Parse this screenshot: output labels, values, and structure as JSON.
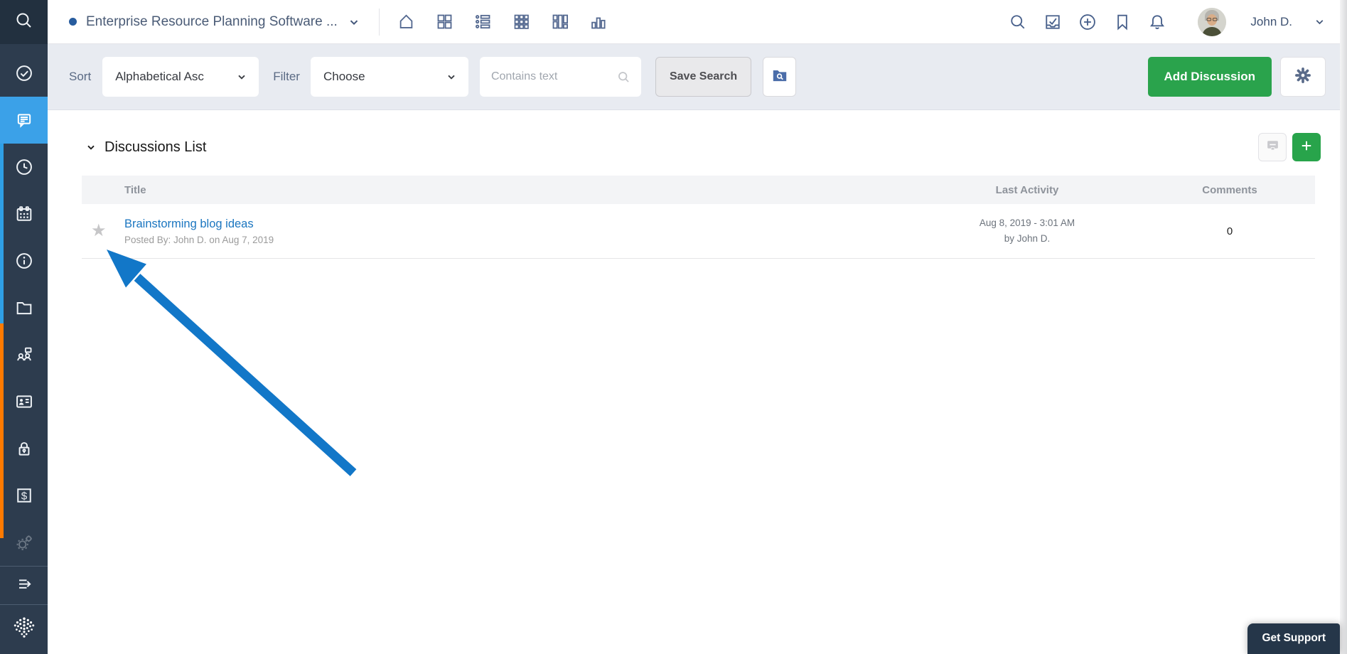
{
  "colors": {
    "sidebar_navy": "#2d3c4e",
    "sidebar_tile": "#22303f",
    "active_item_blue": "#3ba1e8",
    "edge_strip_blue": "#2f9fe5",
    "edge_strip_orange": "#ff7a00",
    "accent_green": "#2aa34c",
    "link_blue": "#1b76c0",
    "annotation_arrow_blue": "#1277c8",
    "support_navy": "#253649"
  },
  "sidebar": {
    "icon_names": [
      "search-icon",
      "check-circle-icon",
      "chat-icon",
      "clock-icon",
      "calendar-icon",
      "info-icon",
      "folder-icon",
      "people-chat-icon",
      "contact-card-icon",
      "lock-icon",
      "dollar-icon",
      "gears-icon",
      "collapse-arrow-icon",
      "brand-logo-icon"
    ],
    "active_item": "discussions"
  },
  "header": {
    "title": "Enterprise Resource Planning Software ...",
    "view_icon_names": [
      "home-icon",
      "grid-2x2-icon",
      "list-icon",
      "grid-3x3-icon",
      "kanban-columns-icon",
      "bar-chart-icon"
    ],
    "right_icon_names": [
      "search-icon",
      "inbox-check-icon",
      "plus-circle-icon",
      "bookmark-icon",
      "bell-icon"
    ],
    "user_name": "John D."
  },
  "toolbar": {
    "sort_label": "Sort",
    "sort_value": "Alphabetical Asc",
    "filter_label": "Filter",
    "filter_value": "Choose",
    "search_placeholder": "Contains text",
    "save_search_label": "Save Search",
    "saved_search_icon": "folder-search-icon",
    "add_button_label": "Add Discussion",
    "settings_icon": "gear-icon"
  },
  "panel": {
    "title": "Discussions List",
    "header_button_icons": [
      "message-square-icon",
      "plus-icon"
    ]
  },
  "table": {
    "columns": [
      "Title",
      "Last Activity",
      "Comments"
    ],
    "rows": [
      {
        "title": "Brainstorming blog ideas",
        "posted_by": "Posted By: John D. on Aug 7, 2019",
        "last_activity_line1": "Aug 8, 2019 - 3:01 AM",
        "last_activity_line2": "by John D.",
        "comments": "0",
        "starred": false
      }
    ]
  },
  "glyphs": {
    "star": "★"
  },
  "support": {
    "label": "Get Support"
  }
}
